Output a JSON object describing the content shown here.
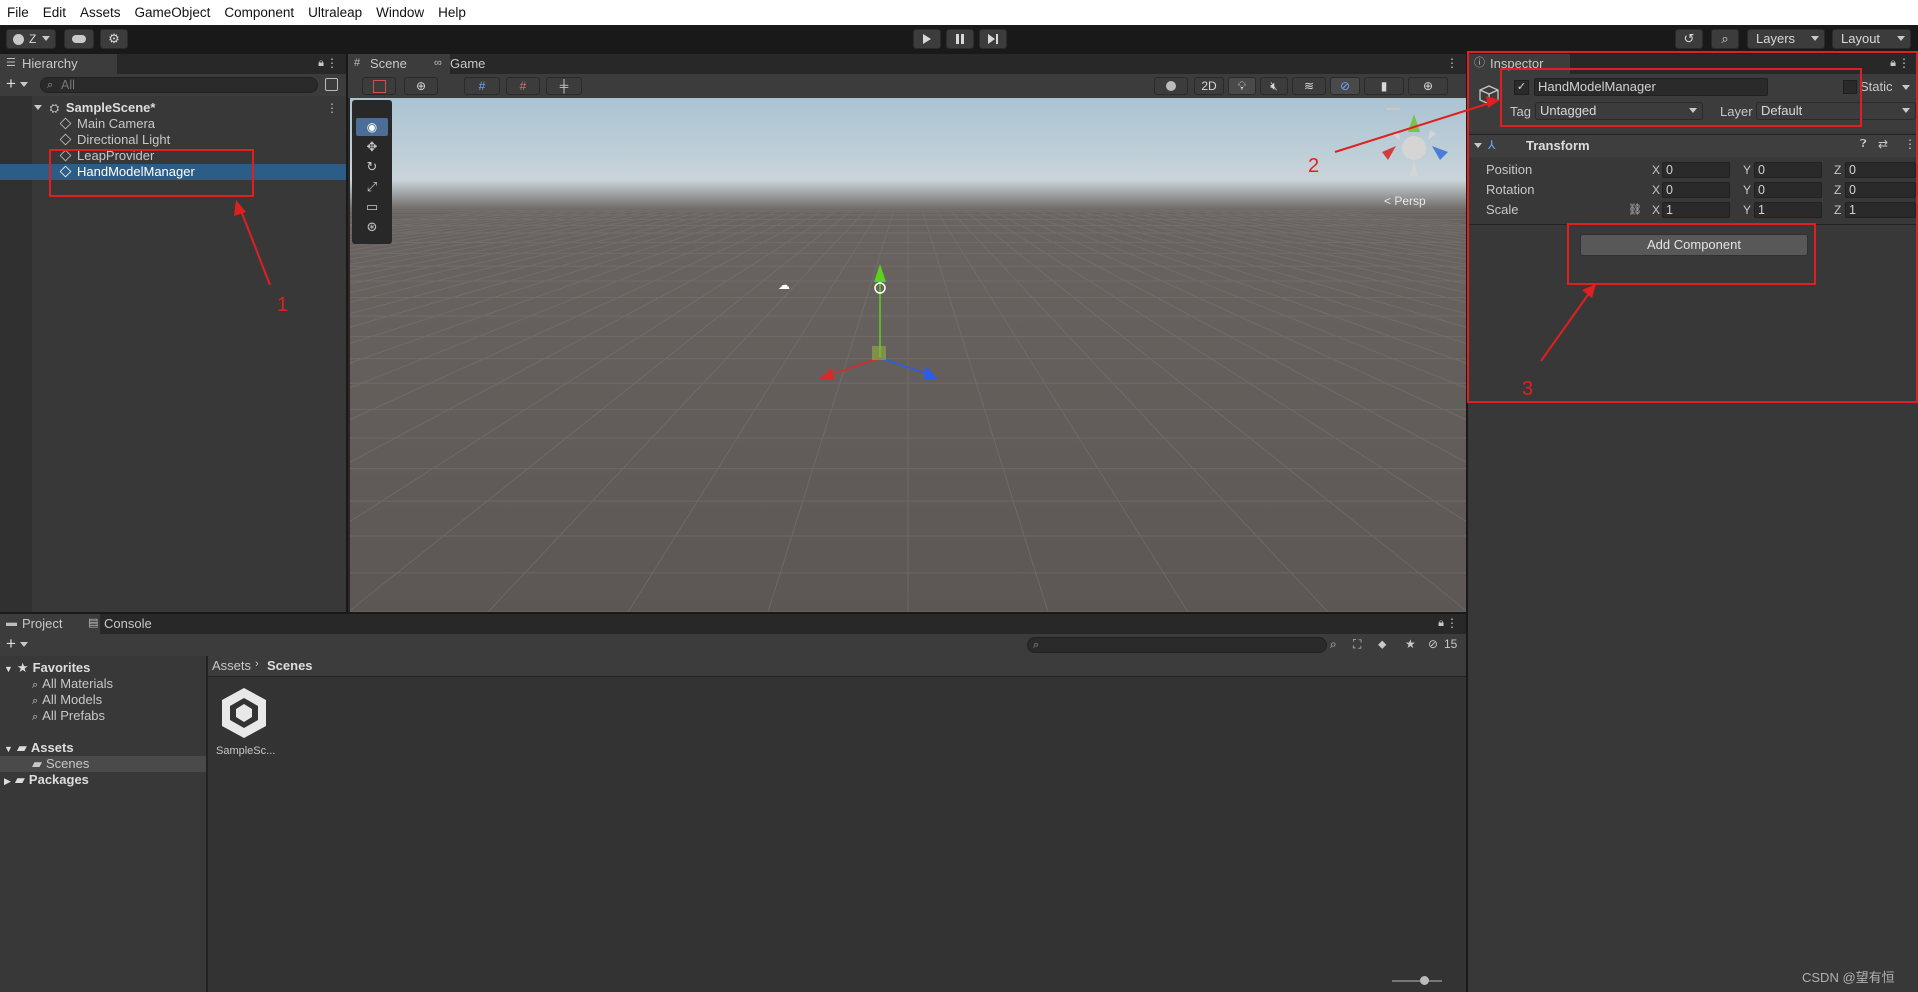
{
  "menu": [
    "File",
    "Edit",
    "Assets",
    "GameObject",
    "Component",
    "Ultraleap",
    "Window",
    "Help"
  ],
  "toolbar": {
    "account_label": "Z",
    "layers_label": "Layers",
    "layout_label": "Layout"
  },
  "hierarchy": {
    "tab_label": "Hierarchy",
    "search_placeholder": "All",
    "scene_name": "SampleScene*",
    "items": [
      {
        "label": "Main Camera"
      },
      {
        "label": "Directional Light"
      },
      {
        "label": "LeapProvider"
      },
      {
        "label": "HandModelManager",
        "selected": true
      }
    ]
  },
  "scene_view": {
    "tabs": [
      {
        "label": "Scene",
        "active": true
      },
      {
        "label": "Game",
        "active": false
      }
    ],
    "toggle_2d": "2D",
    "persp_label": "< Persp"
  },
  "inspector": {
    "tab_label": "Inspector",
    "object_name": "HandModelManager",
    "active_checked": true,
    "static_label": "Static",
    "tag_label": "Tag",
    "tag_value": "Untagged",
    "layer_label": "Layer",
    "layer_value": "Default",
    "transform": {
      "title": "Transform",
      "rows": [
        {
          "label": "Position",
          "x": "0",
          "y": "0",
          "z": "0"
        },
        {
          "label": "Rotation",
          "x": "0",
          "y": "0",
          "z": "0"
        },
        {
          "label": "Scale",
          "x": "1",
          "y": "1",
          "z": "1"
        }
      ],
      "axis_x": "X",
      "axis_y": "Y",
      "axis_z": "Z"
    },
    "add_component_label": "Add Component"
  },
  "project": {
    "tabs": [
      {
        "label": "Project",
        "active": true
      },
      {
        "label": "Console",
        "active": false
      }
    ],
    "hidden_count": "15",
    "tree": {
      "favorites": "Favorites",
      "favorite_items": [
        "All Materials",
        "All Models",
        "All Prefabs"
      ],
      "assets": "Assets",
      "scenes": "Scenes",
      "packages": "Packages"
    },
    "breadcrumb": [
      "Assets",
      "Scenes"
    ],
    "files": [
      {
        "label": "SampleSc..."
      }
    ]
  },
  "annotations": [
    "1",
    "2",
    "3"
  ],
  "watermark": "CSDN @望有恒",
  "colors": {
    "selection": "#2c5d87",
    "annotation_red": "#e02020",
    "accent_axis_red": "#d92a2a",
    "accent_axis_green": "#5ed11e",
    "accent_axis_blue": "#2a5cf0"
  }
}
